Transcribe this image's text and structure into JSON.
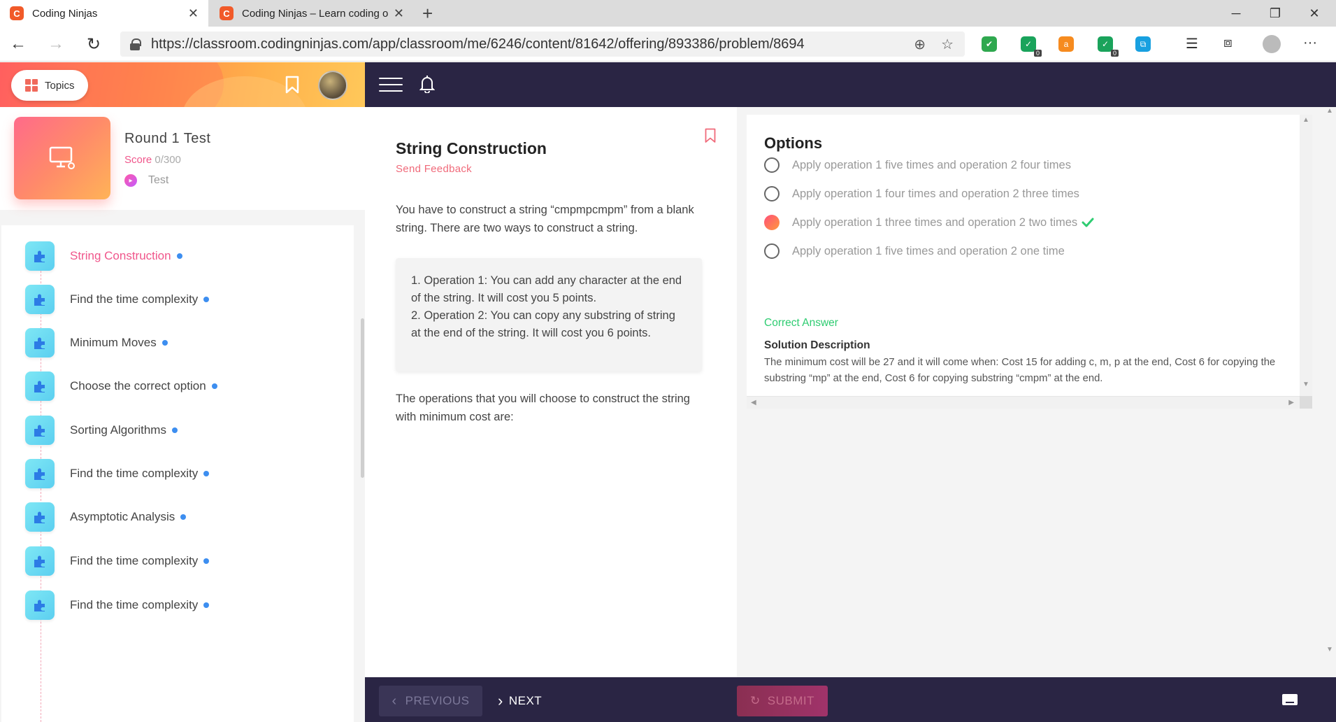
{
  "browser": {
    "tabs": [
      {
        "title": "Coding Ninjas",
        "active": true
      },
      {
        "title": "Coding Ninjas – Learn coding on",
        "active": false
      }
    ],
    "url": "https://classroom.codingninjas.com/app/classroom/me/6246/content/81642/offering/893386/problem/8694",
    "extension_badges": [
      "0",
      "0"
    ],
    "favicon_glyph": "C"
  },
  "header": {
    "topics_label": "Topics"
  },
  "test": {
    "title": "Round 1 Test",
    "score_label": "Score",
    "score_value": "0/300",
    "type": "Test"
  },
  "topics": [
    {
      "label": "String Construction",
      "active": true
    },
    {
      "label": "Find the time complexity",
      "active": false
    },
    {
      "label": "Minimum Moves",
      "active": false
    },
    {
      "label": "Choose the correct option",
      "active": false
    },
    {
      "label": "Sorting Algorithms",
      "active": false
    },
    {
      "label": "Find the time complexity",
      "active": false
    },
    {
      "label": "Asymptotic Analysis",
      "active": false
    },
    {
      "label": "Find the time complexity",
      "active": false
    },
    {
      "label": "Find the time complexity",
      "active": false
    }
  ],
  "question": {
    "title": "String Construction",
    "feedback_link": "Send Feedback",
    "intro": "You have to construct a string “cmpmpcmpm” from a blank string. There are two ways to construct a string.",
    "op1": "1. Operation 1: You can add any character at the end of the string. It will cost you 5 points.",
    "op2": "2. Operation 2: You can copy any substring of string at the end of the string. It will cost you 6 points.",
    "outro": "The operations that you will choose to construct the string with minimum cost are:"
  },
  "options": {
    "heading": "Options",
    "items": [
      {
        "label": "Apply operation 1 five times and operation 2 four times",
        "selected": false,
        "correct": false
      },
      {
        "label": "Apply operation 1 four times and operation 2 three times",
        "selected": false,
        "correct": false
      },
      {
        "label": "Apply operation 1 three times and operation 2 two times",
        "selected": true,
        "correct": true
      },
      {
        "label": "Apply operation 1 five times and operation 2 one time",
        "selected": false,
        "correct": false
      }
    ],
    "correct_answer_label": "Correct Answer",
    "solution_title": "Solution Description",
    "solution_text": "The minimum cost will be 27 and it will come when: Cost 15 for adding c, m, p at the end, Cost 6 for copying the substring “mp” at the end, Cost 6 for copying substring “cmpm” at the end."
  },
  "footer": {
    "previous_label": "PREVIOUS",
    "next_label": "NEXT",
    "submit_label": "SUBMIT"
  },
  "colors": {
    "accent_pink": "#f0568b",
    "dark_bar": "#2a2544",
    "correct_green": "#2ecc71",
    "topic_dot_blue": "#3d8ef0"
  }
}
